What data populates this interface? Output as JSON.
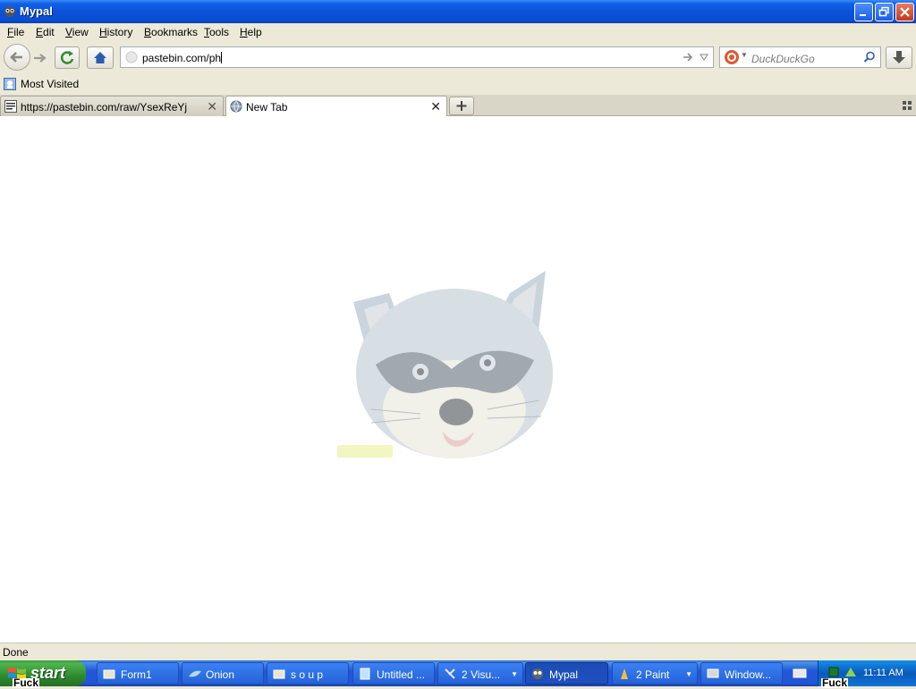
{
  "window": {
    "title": "Mypal"
  },
  "menubar": {
    "items": [
      {
        "label": "File",
        "accel": "F",
        "rest": "ile"
      },
      {
        "label": "Edit",
        "accel": "E",
        "rest": "dit"
      },
      {
        "label": "View",
        "accel": "V",
        "rest": "iew"
      },
      {
        "label": "History",
        "accel": "H",
        "rest": "istory"
      },
      {
        "label": "Bookmarks",
        "accel": "B",
        "rest": "ookmarks"
      },
      {
        "label": "Tools",
        "accel": "T",
        "rest": "ools"
      },
      {
        "label": "Help",
        "accel": "H",
        "rest": "elp"
      }
    ]
  },
  "navbar": {
    "url": "pastebin.com/ph",
    "search_placeholder": "DuckDuckGo"
  },
  "bookmarks": {
    "items": [
      {
        "label": "Most Visited",
        "icon": "most-visited-icon"
      }
    ]
  },
  "tabs": [
    {
      "title": "https://pastebin.com/raw/YsexReYj",
      "active": false,
      "icon": "pastebin-favicon"
    },
    {
      "title": "New Tab",
      "active": true,
      "icon": "globe-icon"
    }
  ],
  "content": {
    "image": "raccoon-mascot"
  },
  "statusbar": {
    "text": "Done"
  },
  "taskbar": {
    "start_label": "start",
    "tasks": [
      {
        "label": "Form1",
        "icon": "folder-icon"
      },
      {
        "label": "Onion",
        "icon": "onion-icon"
      },
      {
        "label": "s o u p",
        "icon": "folder-icon"
      },
      {
        "label": "Untitled ...",
        "icon": "notepad-icon"
      },
      {
        "label": "2 Visu...",
        "icon": "visual-studio-icon",
        "grouped": true
      },
      {
        "label": "Mypal",
        "icon": "mypal-icon",
        "active": true
      },
      {
        "label": "2 Paint",
        "icon": "paint-icon",
        "grouped": true
      },
      {
        "label": "Window...",
        "icon": "window-icon"
      }
    ],
    "clock": "11:11 AM",
    "overlay_text_left": "Fuck",
    "overlay_text_right": "Fuck"
  },
  "colors": {
    "titlebar": "#0a52d8",
    "taskbar": "#2157d7",
    "start_button": "#3c9a3c",
    "chrome": "#ece9d8"
  }
}
